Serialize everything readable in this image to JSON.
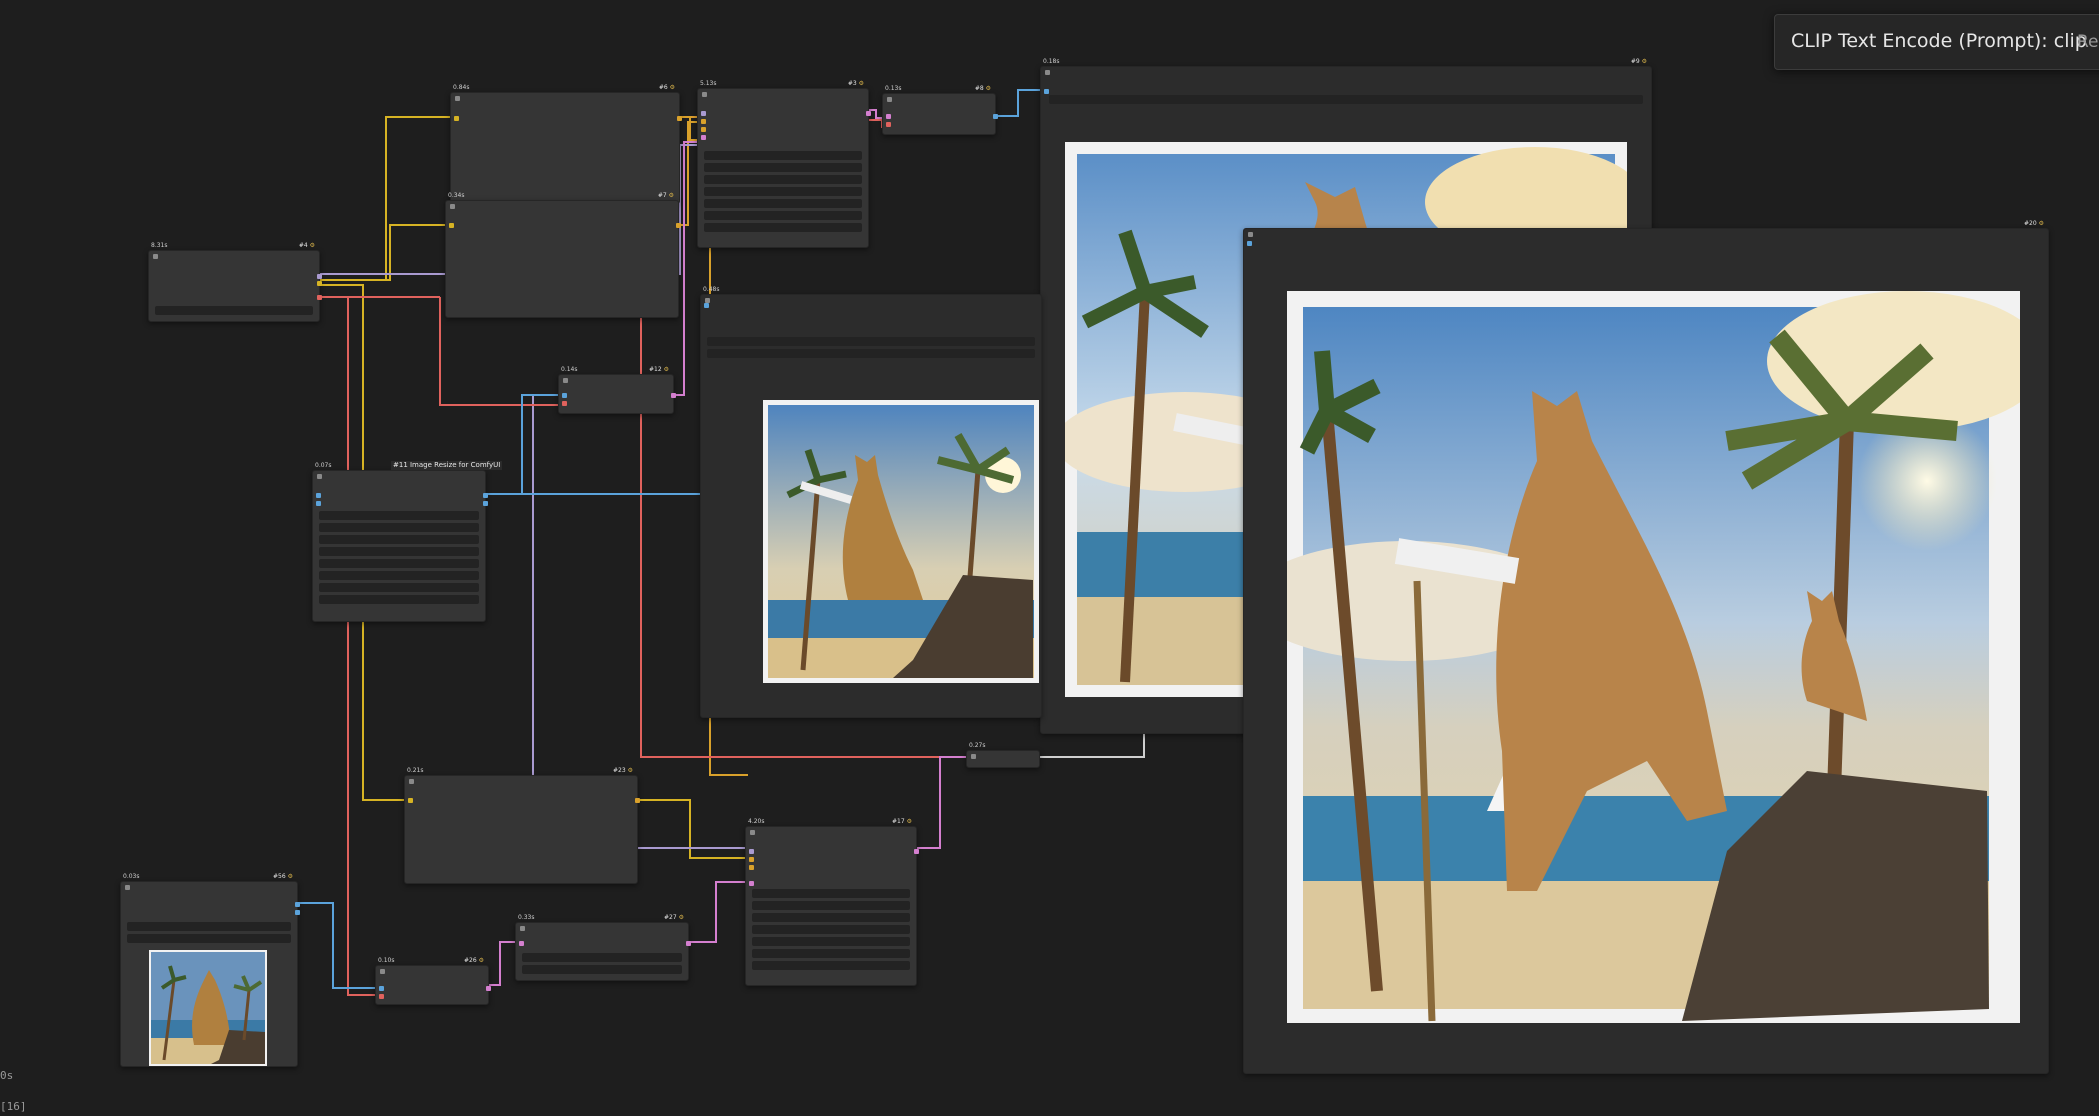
{
  "tooltip": {
    "text": "CLIP Text Encode (Prompt): clip",
    "truncated": "Re"
  },
  "status": {
    "time": "0s",
    "queue": "[16]"
  },
  "colors": {
    "canvas": "#1e1e1e",
    "node": "#353535",
    "wire_clip": "#ffd500",
    "wire_model": "#b39ddb",
    "wire_vae": "#ff6e6e",
    "wire_image": "#64b5f6",
    "wire_latent": "#ff9cf9",
    "wire_cond": "#ffa931",
    "wire_mask": "#e0e0e0"
  },
  "nodes": {
    "ckpt": {
      "time": "8.31s",
      "id": "#4"
    },
    "clip_pos": {
      "time": "0.84s",
      "id": "#6"
    },
    "clip_neg": {
      "time": "0.34s",
      "id": "#7"
    },
    "ksampler1": {
      "time": "5.13s",
      "id": "#3"
    },
    "vae_decode1": {
      "time": "0.13s",
      "id": "#8"
    },
    "save1": {
      "time": "0.18s",
      "id": "#9"
    },
    "preview": {
      "time": "0.48s"
    },
    "vae_encode": {
      "time": "0.14s",
      "id": "#12"
    },
    "resize": {
      "time": "0.07s",
      "id": "#11",
      "title": "#11 Image Resize for ComfyUI"
    },
    "save2": {
      "id": "#20"
    },
    "upscale_model": {
      "time": "0.21s",
      "id": "#23"
    },
    "ksampler2": {
      "time": "4.20s",
      "id": "#17"
    },
    "upscale_mid": {
      "time": "0.27s"
    },
    "load_image": {
      "time": "0.03s",
      "id": "#56"
    },
    "latent_up": {
      "time": "0.10s",
      "id": "#26"
    },
    "latent_mix": {
      "time": "0.33s",
      "id": "#27"
    }
  },
  "images": {
    "thumb": "cat-on-beach-thumbnail",
    "preview": "cat-on-beach-preview",
    "save1": "cat-on-beach-saved",
    "save2": "cat-on-beach-upscaled"
  }
}
